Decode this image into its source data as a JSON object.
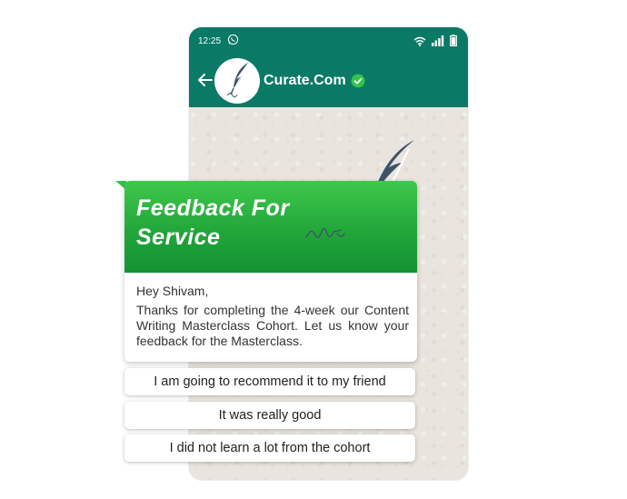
{
  "status_bar": {
    "time": "12:25",
    "app_icon": "whatsapp-icon",
    "icons": [
      "wifi-icon",
      "signal-icon",
      "battery-icon"
    ]
  },
  "header": {
    "back_icon": "arrow-left-icon",
    "avatar_icon": "feather-icon",
    "contact_name": "Curate.Com",
    "verified_icon": "verified-check-icon"
  },
  "card": {
    "title_line1": "Feedback For",
    "title_line2": "Service",
    "greeting": "Hey Shivam,",
    "message": "Thanks for completing the 4-week our Content Writing Masterclass Cohort. Let us know your feedback for the Masterclass."
  },
  "quick_replies": [
    {
      "label": "I am going to recommend it to my friend"
    },
    {
      "label": "It was really good"
    },
    {
      "label": "I did not learn a lot from the cohort"
    }
  ],
  "colors": {
    "header_green": "#0a7a66",
    "banner_green": "#22a63a",
    "verified_green": "#35c24a",
    "feather_blue": "#3d5368"
  }
}
